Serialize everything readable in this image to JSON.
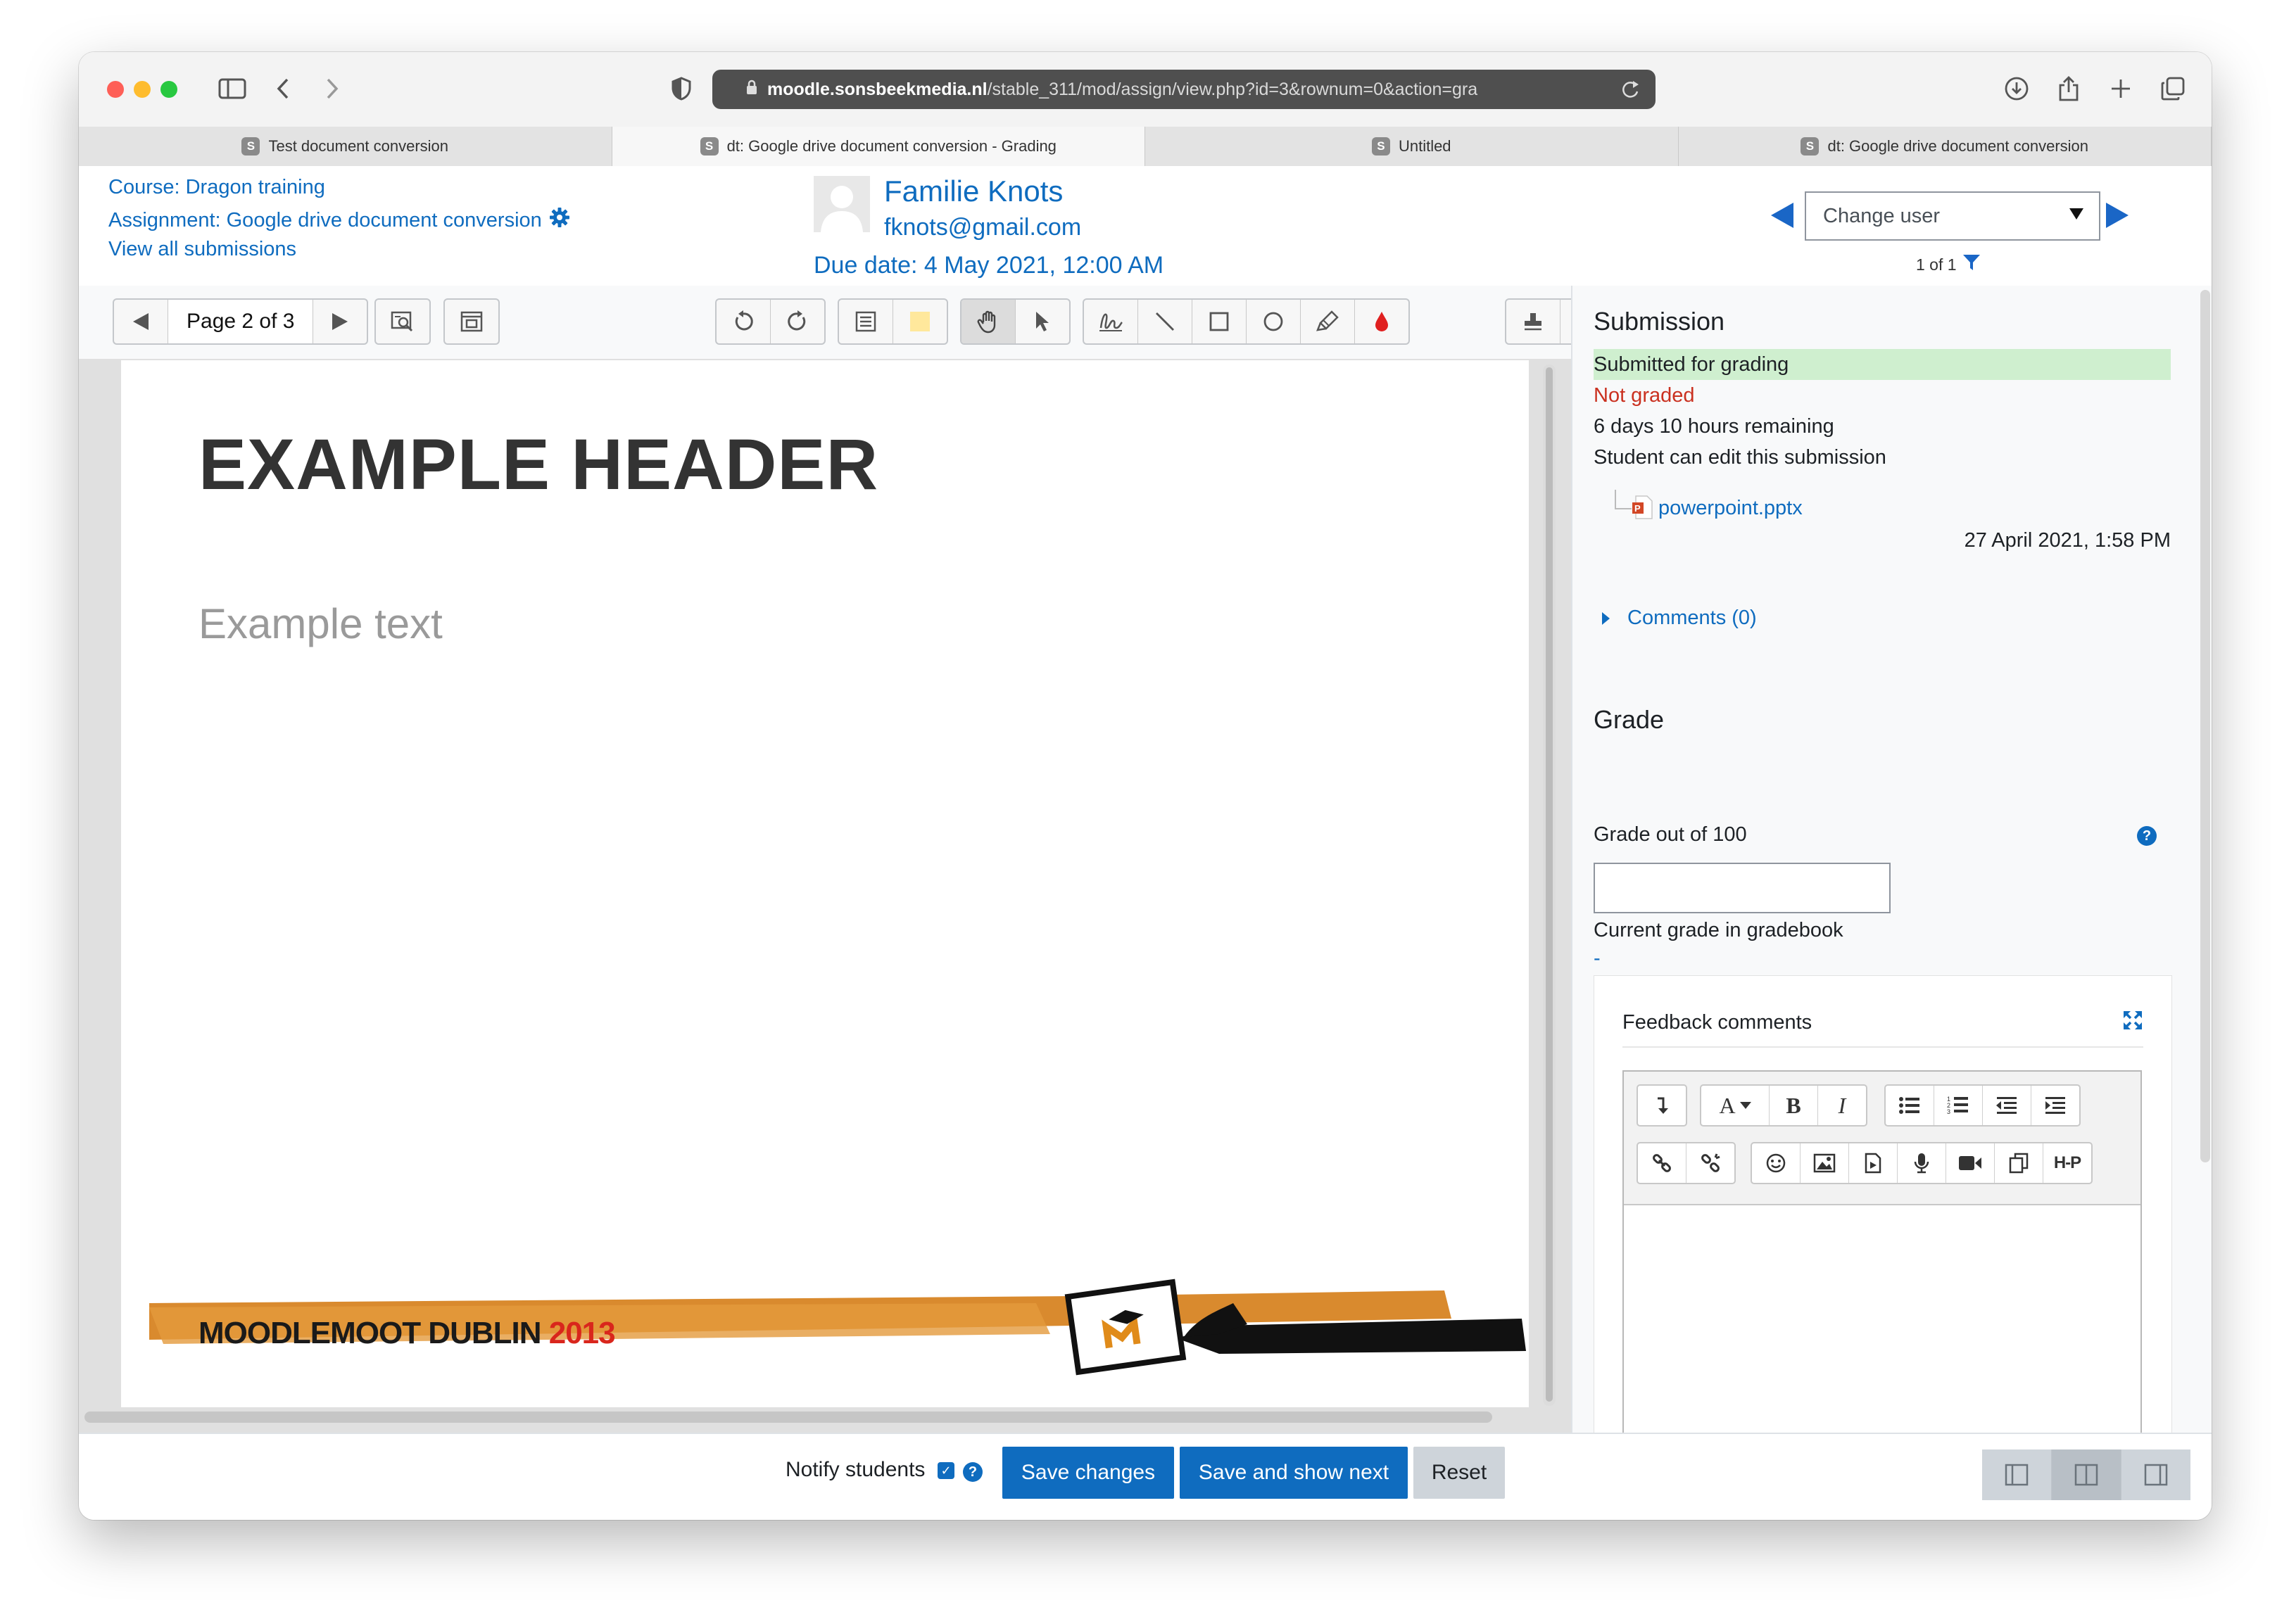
{
  "browser": {
    "url_host": "moodle.sonsbeekmedia.nl",
    "url_path": "/stable_311/mod/assign/view.php?id=3&rownum=0&action=gra",
    "tabs": [
      {
        "favicon": "S",
        "label": "Test document conversion",
        "active": false
      },
      {
        "favicon": "S",
        "label": "dt: Google drive document conversion - Grading",
        "active": true
      },
      {
        "favicon": "S",
        "label": "Untitled",
        "active": false
      },
      {
        "favicon": "S",
        "label": "dt: Google drive document conversion",
        "active": false
      }
    ]
  },
  "header": {
    "course_link": "Course: Dragon training",
    "assignment_link": "Assignment: Google drive document conversion",
    "view_all_link": "View all submissions",
    "user_name": "Familie Knots",
    "user_email": "fknots@gmail.com",
    "due_date": "Due date: 4 May 2021, 12:00 AM",
    "change_user_placeholder": "Change user",
    "user_counter": "1 of 1"
  },
  "annotation_toolbar": {
    "page_label": "Page 2 of 3"
  },
  "document": {
    "header": "EXAMPLE HEADER",
    "text": "Example text",
    "banner_text": "MOODLEMOOT DUBLIN ",
    "banner_year": "2013"
  },
  "submission": {
    "title": "Submission",
    "status_submitted": "Submitted for grading",
    "status_grading": "Not graded",
    "time_remaining": "6 days 10 hours remaining",
    "edit_status": "Student can edit this submission",
    "file_name": "powerpoint.pptx",
    "file_date": "27 April 2021, 1:58 PM",
    "comments_link": "Comments (0)"
  },
  "grade": {
    "title": "Grade",
    "grade_label": "Grade out of 100",
    "grade_value": "",
    "gradebook_label": "Current grade in gradebook",
    "gradebook_value": "-",
    "feedback_label": "Feedback comments"
  },
  "editor_toolbar": {
    "font_button": "A",
    "bold_button": "B",
    "italic_button": "I",
    "h5p_button": "H-P"
  },
  "bottom": {
    "notify_label": "Notify students",
    "notify_checked": true,
    "save_changes": "Save changes",
    "save_and_show_next": "Save and show next",
    "reset": "Reset"
  },
  "colors": {
    "link": "#0f6cbf",
    "primary_button": "#0f6cbf",
    "submitted_bg": "#cfefcf",
    "not_graded": "#ca3120"
  }
}
